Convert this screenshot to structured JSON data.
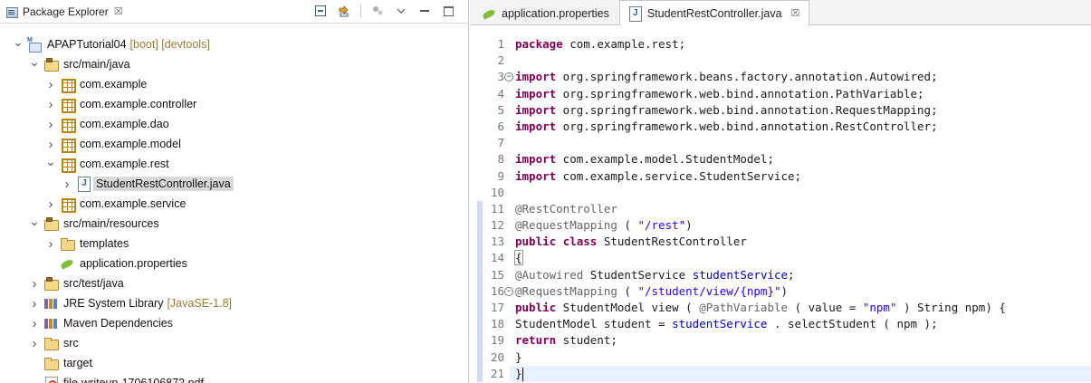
{
  "explorer": {
    "title": "Package Explorer",
    "close_glyph": "☒",
    "tree": [
      {
        "label": "APAPTutorial04",
        "deco": "[boot] [devtools]",
        "icon": "spring-project-icon",
        "twisty": "expanded",
        "depth": 0
      },
      {
        "label": "src/main/java",
        "icon": "source-folder-icon",
        "twisty": "expanded",
        "depth": 1
      },
      {
        "label": "com.example",
        "icon": "package-icon",
        "twisty": "collapsed",
        "depth": 2
      },
      {
        "label": "com.example.controller",
        "icon": "package-icon",
        "twisty": "collapsed",
        "depth": 2
      },
      {
        "label": "com.example.dao",
        "icon": "package-icon",
        "twisty": "collapsed",
        "depth": 2
      },
      {
        "label": "com.example.model",
        "icon": "package-icon",
        "twisty": "collapsed",
        "depth": 2
      },
      {
        "label": "com.example.rest",
        "icon": "package-icon",
        "twisty": "expanded",
        "depth": 2
      },
      {
        "label": "StudentRestController.java",
        "icon": "java-file-icon",
        "twisty": "collapsed",
        "depth": 3,
        "selected": true
      },
      {
        "label": "com.example.service",
        "icon": "package-icon",
        "twisty": "collapsed",
        "depth": 2
      },
      {
        "label": "src/main/resources",
        "icon": "source-folder-icon",
        "twisty": "expanded",
        "depth": 1
      },
      {
        "label": "templates",
        "icon": "folder-icon",
        "twisty": "collapsed",
        "depth": 2
      },
      {
        "label": "application.properties",
        "icon": "properties-file-icon",
        "twisty": "none",
        "depth": 2
      },
      {
        "label": "src/test/java",
        "icon": "source-folder-icon",
        "twisty": "collapsed",
        "depth": 1
      },
      {
        "label": "JRE System Library",
        "deco": "[JavaSE-1.8]",
        "icon": "library-icon",
        "twisty": "collapsed",
        "depth": 1
      },
      {
        "label": "Maven Dependencies",
        "icon": "library-icon",
        "twisty": "collapsed",
        "depth": 1
      },
      {
        "label": "src",
        "icon": "folder-icon",
        "twisty": "collapsed",
        "depth": 1
      },
      {
        "label": "target",
        "icon": "folder-icon",
        "twisty": "none",
        "depth": 1
      },
      {
        "label": "file-writeup-1706106872.pdf",
        "icon": "pdf-file-icon",
        "twisty": "none",
        "depth": 1
      }
    ]
  },
  "editor": {
    "tabs": [
      {
        "label": "application.properties",
        "icon": "properties-file-icon",
        "active": false
      },
      {
        "label": "StudentRestController.java",
        "icon": "java-file-icon",
        "active": true,
        "close_glyph": "☒"
      }
    ],
    "lines": [
      {
        "n": "1",
        "tokens": [
          [
            "kw",
            "package"
          ],
          [
            "t",
            " com.example.rest;"
          ]
        ]
      },
      {
        "n": "2",
        "tokens": []
      },
      {
        "n": "3",
        "fold": true,
        "tokens": [
          [
            "kw",
            "import"
          ],
          [
            "t",
            " org.springframework.beans.factory.annotation.Autowired;"
          ]
        ]
      },
      {
        "n": "4",
        "tokens": [
          [
            "kw",
            "import"
          ],
          [
            "t",
            " org.springframework.web.bind.annotation.PathVariable;"
          ]
        ]
      },
      {
        "n": "5",
        "tokens": [
          [
            "kw",
            "import"
          ],
          [
            "t",
            " org.springframework.web.bind.annotation.RequestMapping;"
          ]
        ]
      },
      {
        "n": "6",
        "tokens": [
          [
            "kw",
            "import"
          ],
          [
            "t",
            " org.springframework.web.bind.annotation.RestController;"
          ]
        ]
      },
      {
        "n": "7",
        "tokens": []
      },
      {
        "n": "8",
        "tokens": [
          [
            "kw",
            "import"
          ],
          [
            "t",
            " com.example.model.StudentModel;"
          ]
        ]
      },
      {
        "n": "9",
        "tokens": [
          [
            "kw",
            "import"
          ],
          [
            "t",
            " com.example.service.StudentService;"
          ]
        ]
      },
      {
        "n": "10",
        "tokens": []
      },
      {
        "n": "11",
        "mark": true,
        "tokens": [
          [
            "ann",
            "@RestController"
          ]
        ]
      },
      {
        "n": "12",
        "mark": true,
        "tokens": [
          [
            "ann",
            "@RequestMapping"
          ],
          [
            "t",
            " ( "
          ],
          [
            "str",
            "\"/rest\""
          ],
          [
            "t",
            ")"
          ]
        ]
      },
      {
        "n": "13",
        "mark": true,
        "tokens": [
          [
            "kw",
            "public"
          ],
          [
            "t",
            " "
          ],
          [
            "kw",
            "class"
          ],
          [
            "t",
            " StudentRestController"
          ]
        ]
      },
      {
        "n": "14",
        "mark": true,
        "tokens": [
          [
            "box",
            "{"
          ]
        ]
      },
      {
        "n": "15",
        "mark": true,
        "tokens": [
          [
            "ann",
            "@Autowired"
          ],
          [
            "t",
            " StudentService "
          ],
          [
            "fld",
            "studentService"
          ],
          [
            "t",
            ";"
          ]
        ]
      },
      {
        "n": "16",
        "mark": true,
        "fold": true,
        "tokens": [
          [
            "ann",
            "@RequestMapping"
          ],
          [
            "t",
            " ( "
          ],
          [
            "str",
            "\"/student/view/{npm}\""
          ],
          [
            "t",
            ")"
          ]
        ]
      },
      {
        "n": "17",
        "mark": true,
        "tokens": [
          [
            "kw",
            "public"
          ],
          [
            "t",
            " StudentModel view ( "
          ],
          [
            "ann",
            "@PathVariable"
          ],
          [
            "t",
            " ( value = "
          ],
          [
            "str",
            "\"npm\""
          ],
          [
            "t",
            " ) String npm) {"
          ]
        ]
      },
      {
        "n": "18",
        "mark": true,
        "tokens": [
          [
            "t",
            "StudentModel student = "
          ],
          [
            "fld",
            "studentService"
          ],
          [
            "t",
            " . selectStudent ( npm );"
          ]
        ]
      },
      {
        "n": "19",
        "mark": true,
        "tokens": [
          [
            "kw",
            "return"
          ],
          [
            "t",
            " student;"
          ]
        ]
      },
      {
        "n": "20",
        "mark": true,
        "tokens": [
          [
            "t",
            "}"
          ]
        ]
      },
      {
        "n": "21",
        "mark": true,
        "current": true,
        "tokens": [
          [
            "t",
            "}"
          ],
          [
            "cursor",
            ""
          ]
        ]
      }
    ]
  }
}
